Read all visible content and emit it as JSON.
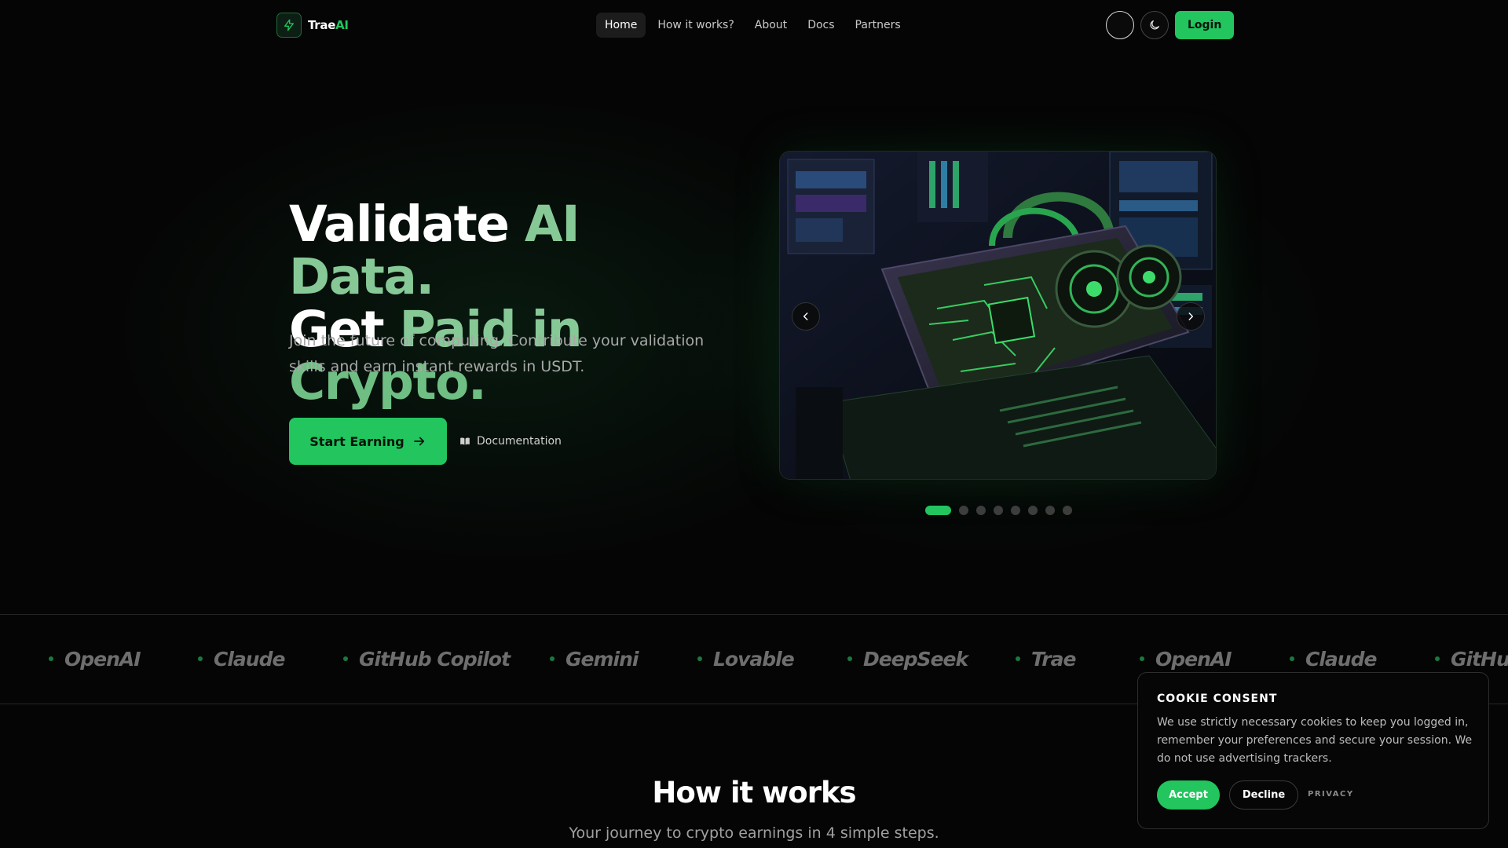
{
  "brand": {
    "name_part1": "Trae",
    "name_part2": "AI",
    "accent": "#22c55e",
    "logo_icon": "bolt-icon"
  },
  "nav": {
    "links": [
      {
        "label": "Home",
        "active": true
      },
      {
        "label": "How it works?"
      },
      {
        "label": "About"
      },
      {
        "label": "Docs"
      },
      {
        "label": "Partners"
      }
    ],
    "theme_icon": "moon-icon",
    "login_label": "Login"
  },
  "hero": {
    "title_line1_a": "Validate ",
    "title_line1_b": "AI Data.",
    "title_line2_a": "Get ",
    "title_line2_b": "Paid in ",
    "title_line2_c": "Crypto.",
    "subtitle": "Join the future of computing. Contribute your validation skills and earn instant rewards in USDT.",
    "cta_label": "Start Earning",
    "cta_icon": "arrow-right-icon",
    "doc_label": "Documentation",
    "doc_icon": "book-icon"
  },
  "carousel": {
    "slide_count": 8,
    "active_index": 0,
    "prev_icon": "chevron-left-icon",
    "next_icon": "chevron-right-icon"
  },
  "partners": [
    "OpenAI",
    "Claude",
    "GitHub Copilot",
    "Gemini",
    "Lovable",
    "DeepSeek",
    "Trae",
    "OpenAI",
    "Claude",
    "GitHub"
  ],
  "how_it_works": {
    "title": "How it works",
    "subtitle": "Your journey to crypto earnings in 4 simple steps."
  },
  "cookie": {
    "title": "COOKIE CONSENT",
    "text": "We use strictly necessary cookies to keep you logged in, remember your preferences and secure your session. We do not use advertising trackers.",
    "accept_label": "Accept",
    "decline_label": "Decline",
    "privacy_label": "PRIVACY"
  }
}
